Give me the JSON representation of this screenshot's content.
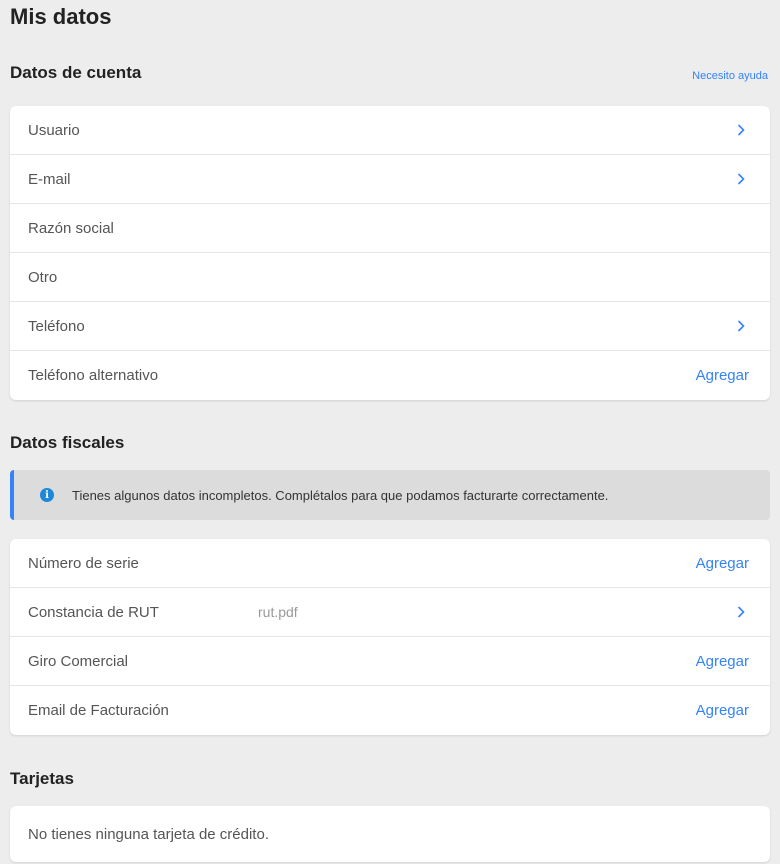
{
  "page": {
    "title": "Mis datos"
  },
  "account": {
    "title": "Datos de cuenta",
    "help_link": "Necesito ayuda",
    "rows": [
      {
        "label": "Usuario",
        "action": "",
        "chevron": true
      },
      {
        "label": "E-mail",
        "action": "",
        "chevron": true
      },
      {
        "label": "Razón social",
        "action": "",
        "chevron": false
      },
      {
        "label": "Otro",
        "action": "",
        "chevron": false
      },
      {
        "label": "Teléfono",
        "action": "",
        "chevron": true
      },
      {
        "label": "Teléfono alternativo",
        "action": "Agregar",
        "chevron": false
      }
    ]
  },
  "fiscal": {
    "title": "Datos fiscales",
    "notice": "Tienes algunos datos incompletos. Complétalos para que podamos facturarte correctamente.",
    "notice_icon": "info-icon",
    "rows": [
      {
        "label": "Número de serie",
        "value": "",
        "action": "Agregar",
        "chevron": false
      },
      {
        "label": "Constancia de RUT",
        "value": "rut.pdf",
        "action": "",
        "chevron": true
      },
      {
        "label": "Giro Comercial",
        "value": "",
        "action": "Agregar",
        "chevron": false
      },
      {
        "label": "Email de Facturación",
        "value": "",
        "action": "Agregar",
        "chevron": false
      }
    ]
  },
  "cards": {
    "title": "Tarjetas",
    "empty_text": "No tienes ninguna tarjeta de crédito."
  },
  "colors": {
    "accent": "#3483fa",
    "background": "#ededed",
    "notice_bg": "#dcdcdc"
  }
}
